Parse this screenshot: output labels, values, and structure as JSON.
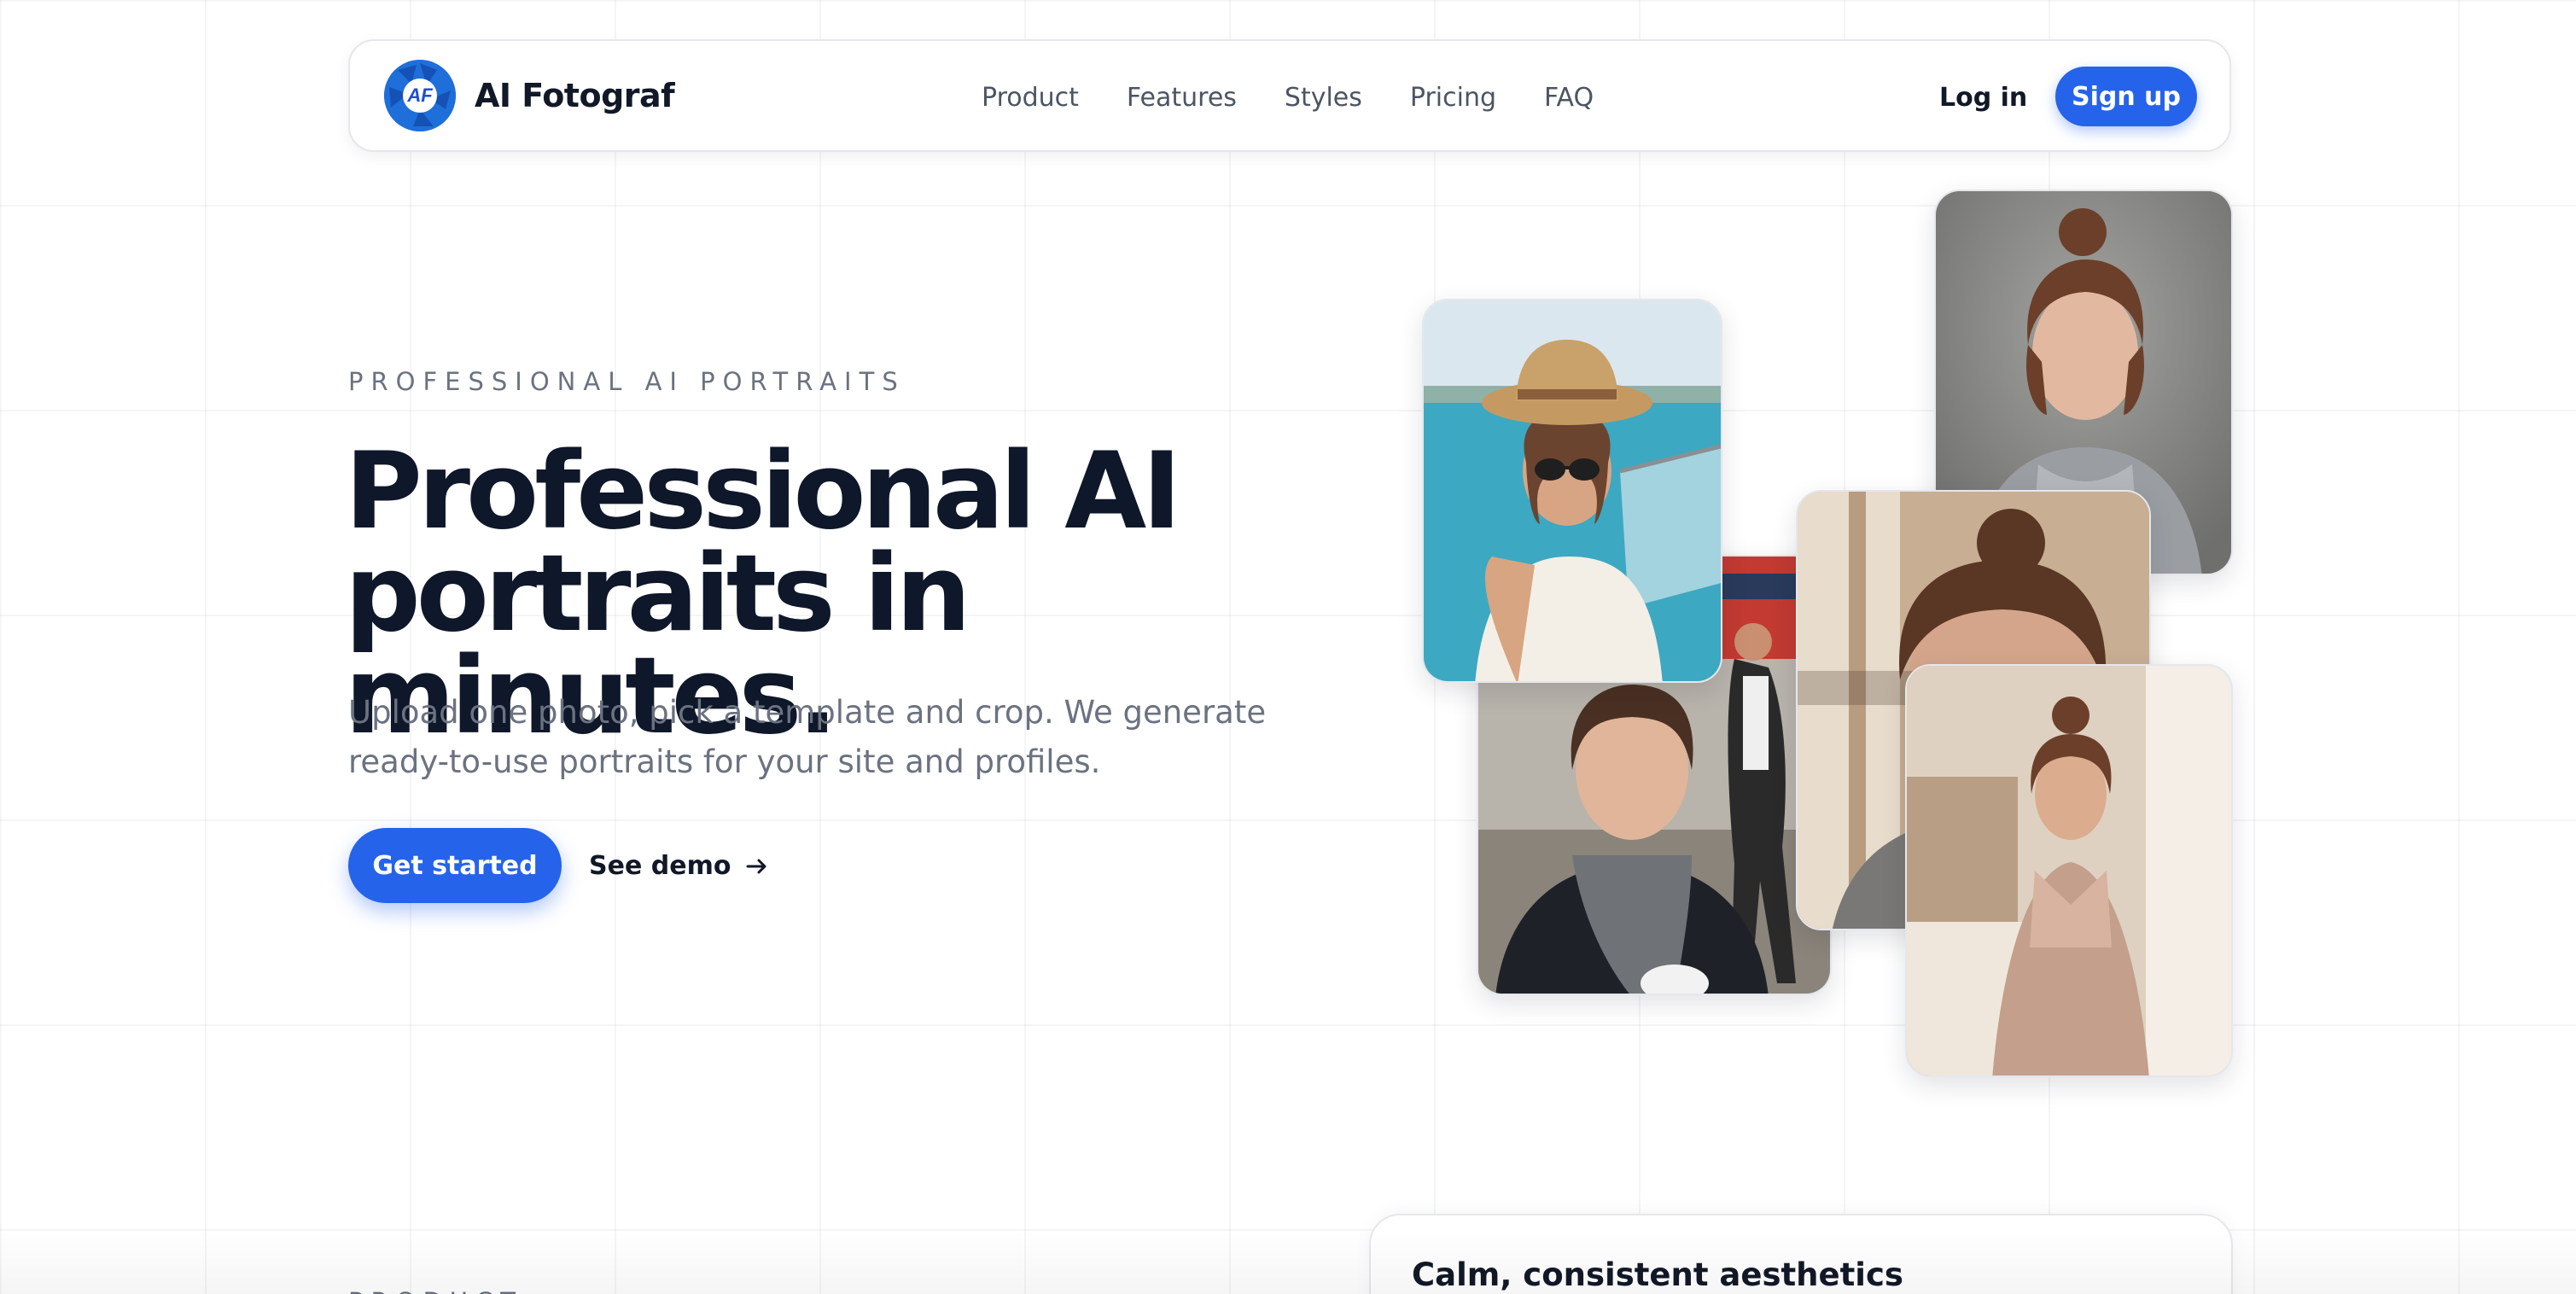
{
  "brand": {
    "name": "AI Fotograf",
    "logo_letters": "AF",
    "accent": "#2563eb"
  },
  "nav": {
    "links": [
      "Product",
      "Features",
      "Styles",
      "Pricing",
      "FAQ"
    ],
    "login": "Log in",
    "signup": "Sign up"
  },
  "hero": {
    "eyebrow": "PROFESSIONAL AI PORTRAITS",
    "headline_line1": "Professional AI",
    "headline_line2": "portraits in minutes.",
    "subtitle": "Upload one photo, pick a template and crop. We generate ready-to-use portraits for your site and profiles.",
    "cta_primary": "Get started",
    "cta_secondary": "See demo",
    "cta_secondary_icon": "arrow-right-icon"
  },
  "gallery": {
    "photos": [
      {
        "name": "beach-portrait-photo",
        "scene": "woman in straw hat and sunglasses by the sea"
      },
      {
        "name": "hoodie-portrait-photo",
        "scene": "woman in grey hoodie against grey backdrop"
      },
      {
        "name": "street-portrait-photo",
        "scene": "woman with scarf in street cafe"
      },
      {
        "name": "window-portrait-photo",
        "scene": "woman close-up near window"
      },
      {
        "name": "bedroom-portrait-photo",
        "scene": "woman in pink blouse in bedroom"
      }
    ]
  },
  "bottom": {
    "card_title": "Calm, consistent aesthetics",
    "eyebrow": "PRODUCT"
  }
}
